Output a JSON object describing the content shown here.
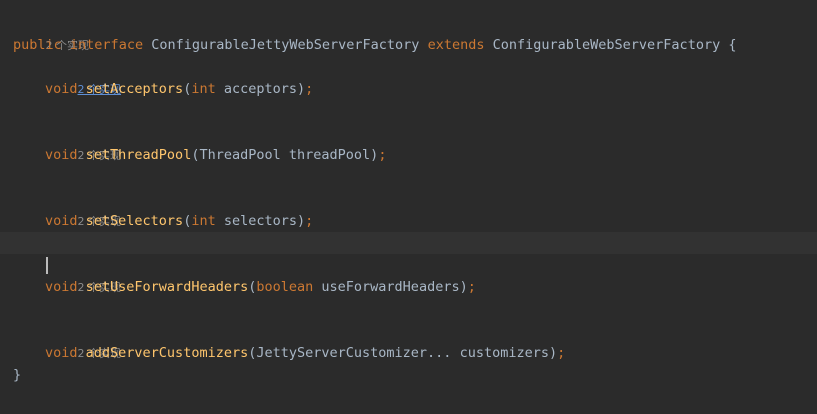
{
  "hints": {
    "interface_usages": "2 个实现",
    "set_acceptors": "2 个实现",
    "set_thread_pool": "2 个实现",
    "set_selectors": "2 个实现",
    "set_use_forward_headers": "2 个实现",
    "add_server_customizers": "2 个实现"
  },
  "interface_decl": {
    "modifier": "public",
    "keyword": "interface",
    "name": "ConfigurableJettyWebServerFactory",
    "extends_kw": "extends",
    "parent": "ConfigurableWebServerFactory",
    "open_brace": "{"
  },
  "methods": [
    {
      "ret": "void",
      "name": "setAcceptors",
      "open": "(",
      "param_kw": "int",
      "param_type": "",
      "param": "acceptors",
      "close": ")",
      "semi": ";"
    },
    {
      "ret": "void",
      "name": "setThreadPool",
      "open": "(",
      "param_kw": "",
      "param_type": "ThreadPool",
      "param": "threadPool",
      "close": ")",
      "semi": ";"
    },
    {
      "ret": "void",
      "name": "setSelectors",
      "open": "(",
      "param_kw": "int",
      "param_type": "",
      "param": "selectors",
      "close": ")",
      "semi": ";"
    },
    {
      "ret": "void",
      "name": "setUseForwardHeaders",
      "open": "(",
      "param_kw": "boolean",
      "param_type": "",
      "param": "useForwardHeaders",
      "close": ")",
      "semi": ";"
    },
    {
      "ret": "void",
      "name": "addServerCustomizers",
      "open": "(",
      "param_kw": "",
      "param_type": "JettyServerCustomizer...",
      "param": "customizers",
      "close": ")",
      "semi": ";"
    }
  ],
  "close_brace": "}"
}
